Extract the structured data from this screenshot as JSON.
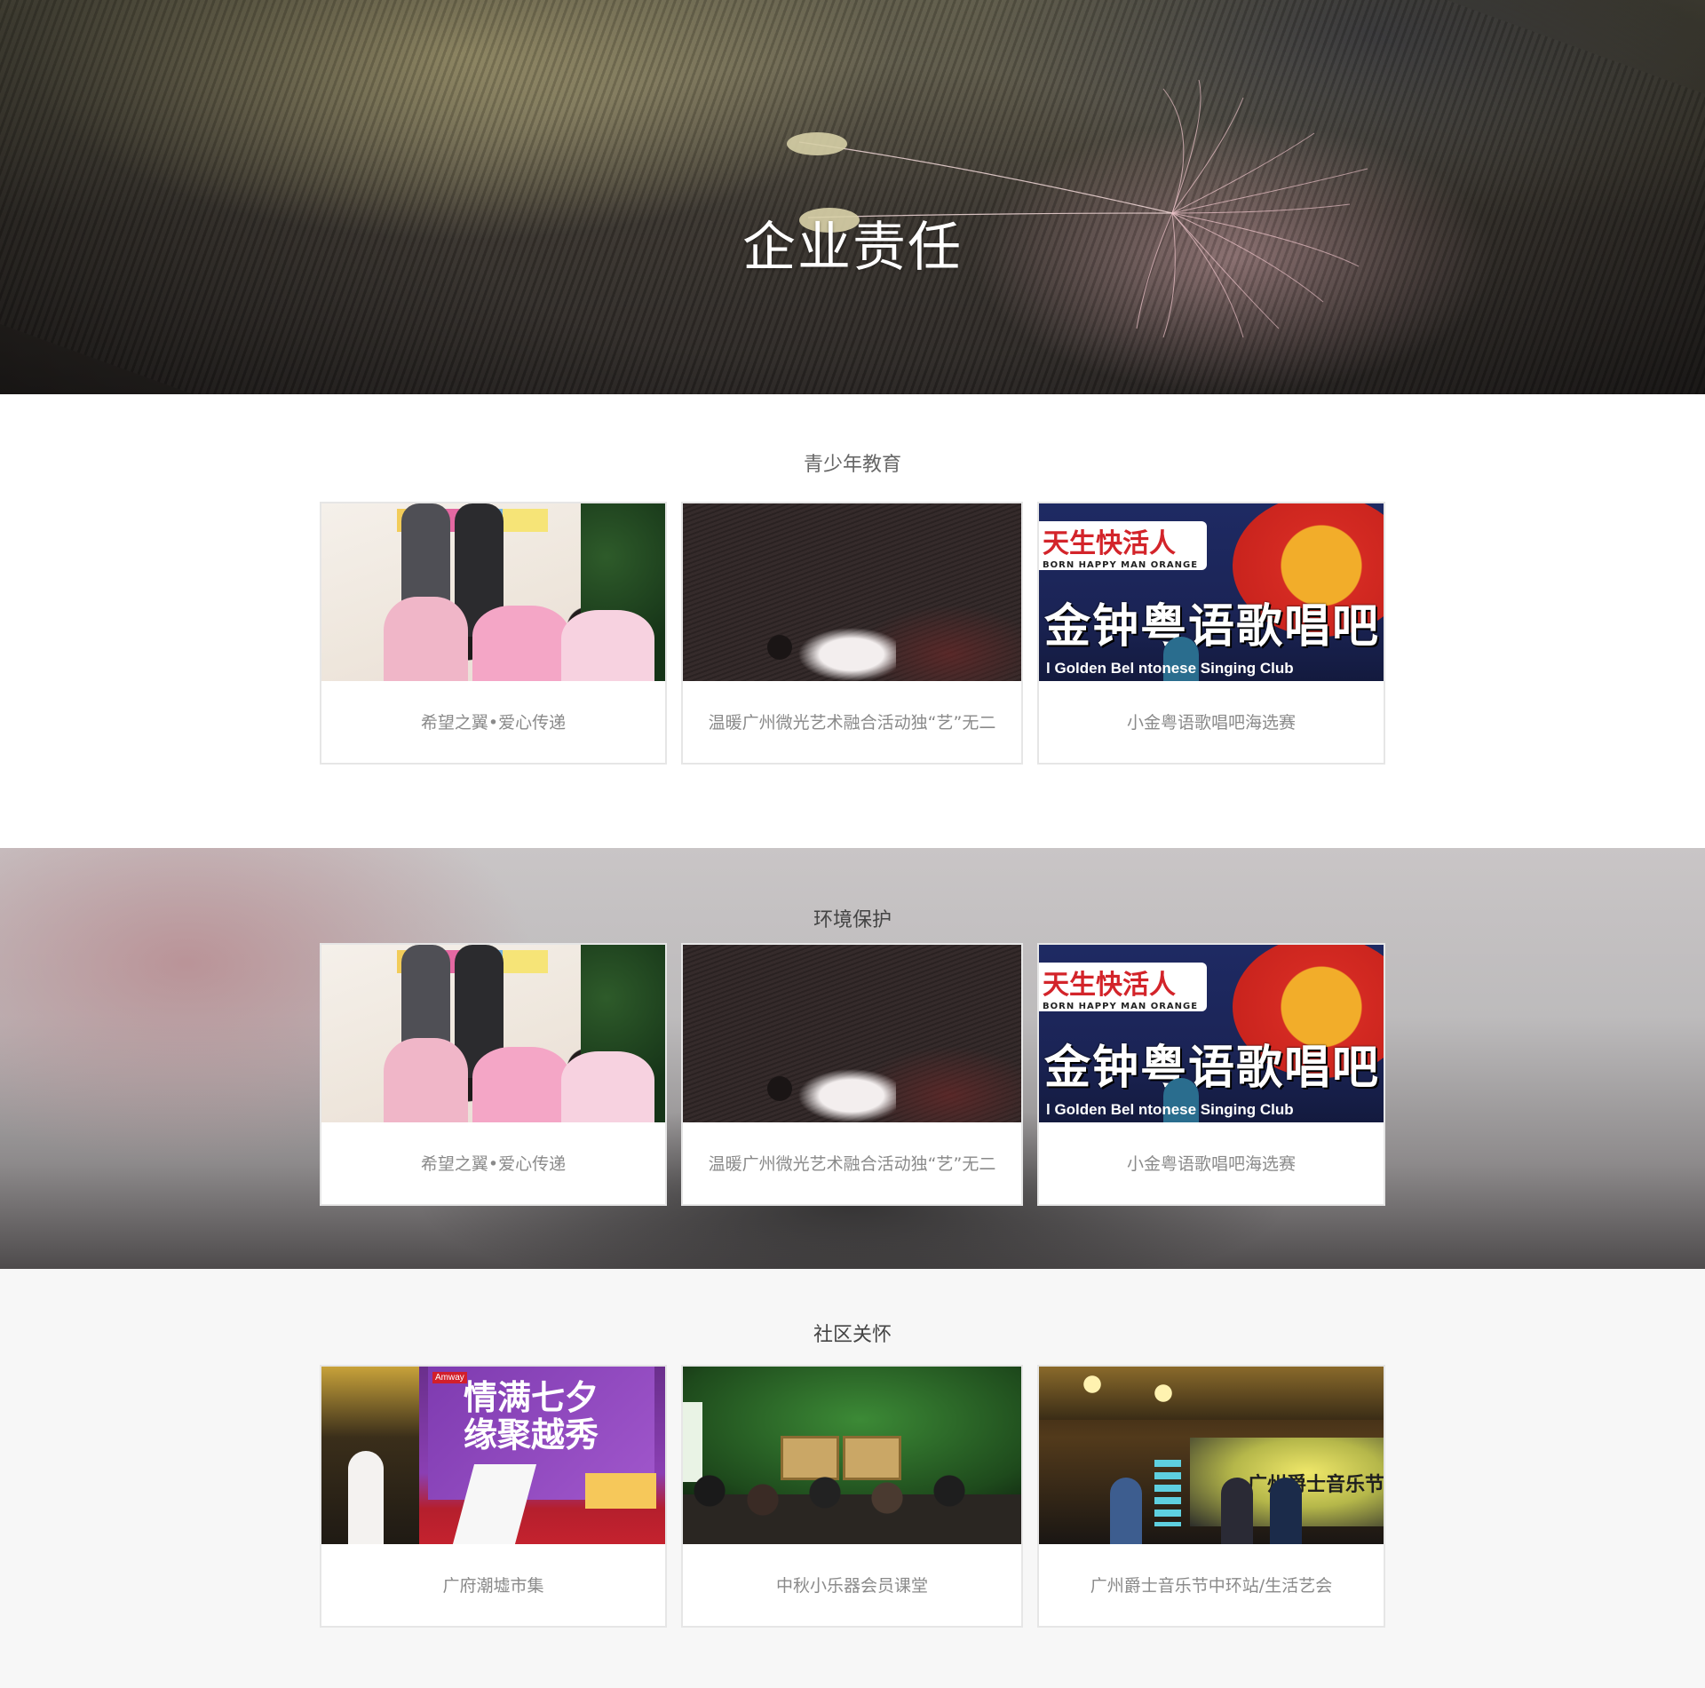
{
  "hero": {
    "title": "企业责任"
  },
  "sections": [
    {
      "title": "青少年教育",
      "cards": [
        {
          "caption": "希望之翼•爱心传递",
          "image": "children-drawing-photo"
        },
        {
          "caption": "温暖广州微光艺术融合活动独“艺”无二",
          "image": "dancer-photo"
        },
        {
          "caption": "小金粤语歌唱吧海选赛",
          "image": "singing-club-photo"
        }
      ]
    },
    {
      "title": "环境保护",
      "cards": [
        {
          "caption": "希望之翼•爱心传递",
          "image": "children-drawing-photo"
        },
        {
          "caption": "温暖广州微光艺术融合活动独“艺”无二",
          "image": "dancer-photo"
        },
        {
          "caption": "小金粤语歌唱吧海选赛",
          "image": "singing-club-photo"
        }
      ]
    },
    {
      "title": "社区关怀",
      "cards": [
        {
          "caption": "广府潮墟市集",
          "image": "market-stage-photo"
        },
        {
          "caption": "中秋小乐器会员课堂",
          "image": "music-class-photo"
        },
        {
          "caption": "广州爵士音乐节中环站/生活艺会",
          "image": "jazz-festival-photo"
        }
      ]
    }
  ],
  "photo_text": {
    "singing_top": "天生快活人",
    "singing_top_en": "BORN HAPPY MAN ORANGE",
    "singing_main": "金钟粤语歌唱吧",
    "singing_sub": "l Golden Bel  ntonese Singing Club",
    "market_logo": "Amway",
    "market_board": "情满七夕\n缘聚越秀",
    "jazz_stage": "广州爵士音乐节"
  }
}
